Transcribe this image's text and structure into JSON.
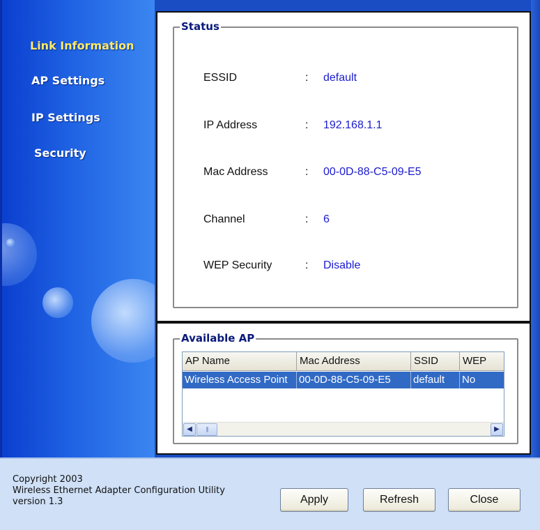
{
  "sidebar": {
    "items": [
      {
        "label": "Link Information",
        "active": true
      },
      {
        "label": "AP Settings",
        "active": false
      },
      {
        "label": "IP Settings",
        "active": false
      },
      {
        "label": "Security",
        "active": false
      }
    ]
  },
  "status": {
    "title": "Status",
    "fields": [
      {
        "label": "ESSID",
        "value": "default"
      },
      {
        "label": "IP Address",
        "value": "192.168.1.1"
      },
      {
        "label": "Mac Address",
        "value": "00-0D-88-C5-09-E5"
      },
      {
        "label": "Channel",
        "value": "6"
      },
      {
        "label": "WEP Security",
        "value": "Disable"
      }
    ],
    "colon": ":"
  },
  "available_ap": {
    "title": "Available AP",
    "columns": [
      "AP Name",
      "Mac Address",
      "SSID",
      "WEP"
    ],
    "rows": [
      [
        "Wireless Access Point",
        "00-0D-88-C5-09-E5",
        "default",
        "No"
      ]
    ]
  },
  "footer": {
    "copyright": "Copyright 2003",
    "product": "Wireless Ethernet Adapter Configuration Utility",
    "version": "version 1.3",
    "buttons": {
      "apply": "Apply",
      "refresh": "Refresh",
      "close": "Close"
    }
  },
  "colors": {
    "accent": "#316ac5",
    "active_nav": "#ffeb6a",
    "value_text": "#1a1ad0"
  }
}
